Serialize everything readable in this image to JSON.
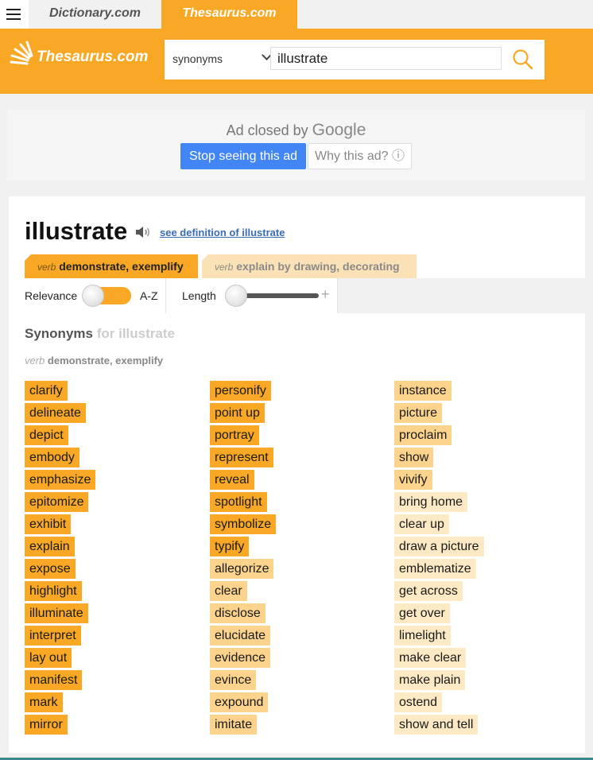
{
  "tabs": {
    "dictionary": "Dictionary.com",
    "thesaurus": "Thesaurus.com"
  },
  "header": {
    "logo_text": "Thesaurus.com",
    "search_type": "synonyms",
    "query": "illustrate"
  },
  "ad": {
    "closed_text": "Ad closed by",
    "brand": "Google",
    "stop_button": "Stop seeing this ad",
    "why_button": "Why this ad? ⓘ"
  },
  "entry": {
    "word": "illustrate",
    "definition_link": "see definition of illustrate"
  },
  "senses": [
    {
      "pos": "verb",
      "label": "demonstrate, exemplify"
    },
    {
      "pos": "verb",
      "label": "explain by drawing, decorating"
    }
  ],
  "controls": {
    "relevance": "Relevance",
    "az": "A-Z",
    "length": "Length",
    "plus": "+"
  },
  "synonyms_title": "Synonyms",
  "synonyms_for": "for illustrate",
  "active_sense": {
    "pos": "verb",
    "label": "demonstrate, exemplify"
  },
  "columns": [
    [
      {
        "word": "clarify",
        "rel": 3
      },
      {
        "word": "delineate",
        "rel": 3
      },
      {
        "word": "depict",
        "rel": 3
      },
      {
        "word": "embody",
        "rel": 3
      },
      {
        "word": "emphasize",
        "rel": 3
      },
      {
        "word": "epitomize",
        "rel": 3
      },
      {
        "word": "exhibit",
        "rel": 3
      },
      {
        "word": "explain",
        "rel": 3
      },
      {
        "word": "expose",
        "rel": 3
      },
      {
        "word": "highlight",
        "rel": 3
      },
      {
        "word": "illuminate",
        "rel": 3
      },
      {
        "word": "interpret",
        "rel": 3
      },
      {
        "word": "lay out",
        "rel": 3
      },
      {
        "word": "manifest",
        "rel": 3
      },
      {
        "word": "mark",
        "rel": 3
      },
      {
        "word": "mirror",
        "rel": 3
      }
    ],
    [
      {
        "word": "personify",
        "rel": 3
      },
      {
        "word": "point up",
        "rel": 3
      },
      {
        "word": "portray",
        "rel": 3
      },
      {
        "word": "represent",
        "rel": 3
      },
      {
        "word": "reveal",
        "rel": 3
      },
      {
        "word": "spotlight",
        "rel": 3
      },
      {
        "word": "symbolize",
        "rel": 3
      },
      {
        "word": "typify",
        "rel": 3
      },
      {
        "word": "allegorize",
        "rel": 2
      },
      {
        "word": "clear",
        "rel": 2
      },
      {
        "word": "disclose",
        "rel": 2
      },
      {
        "word": "elucidate",
        "rel": 2
      },
      {
        "word": "evidence",
        "rel": 2
      },
      {
        "word": "evince",
        "rel": 2
      },
      {
        "word": "expound",
        "rel": 2
      },
      {
        "word": "imitate",
        "rel": 2
      }
    ],
    [
      {
        "word": "instance",
        "rel": 2
      },
      {
        "word": "picture",
        "rel": 2
      },
      {
        "word": "proclaim",
        "rel": 2
      },
      {
        "word": "show",
        "rel": 2
      },
      {
        "word": "vivify",
        "rel": 2
      },
      {
        "word": "bring home",
        "rel": 1
      },
      {
        "word": "clear up",
        "rel": 1
      },
      {
        "word": "draw a picture",
        "rel": 1
      },
      {
        "word": "emblematize",
        "rel": 1
      },
      {
        "word": "get across",
        "rel": 1
      },
      {
        "word": "get over",
        "rel": 1
      },
      {
        "word": "limelight",
        "rel": 1
      },
      {
        "word": "make clear",
        "rel": 1
      },
      {
        "word": "make plain",
        "rel": 1
      },
      {
        "word": "ostend",
        "rel": 1
      },
      {
        "word": "show and tell",
        "rel": 1
      }
    ]
  ],
  "colors": {
    "brand_orange": "#f8a825",
    "rel_high": "#f8a825",
    "rel_mid": "#fbd38c",
    "rel_low": "#fde9c4",
    "ad_blue": "#4285f4"
  }
}
